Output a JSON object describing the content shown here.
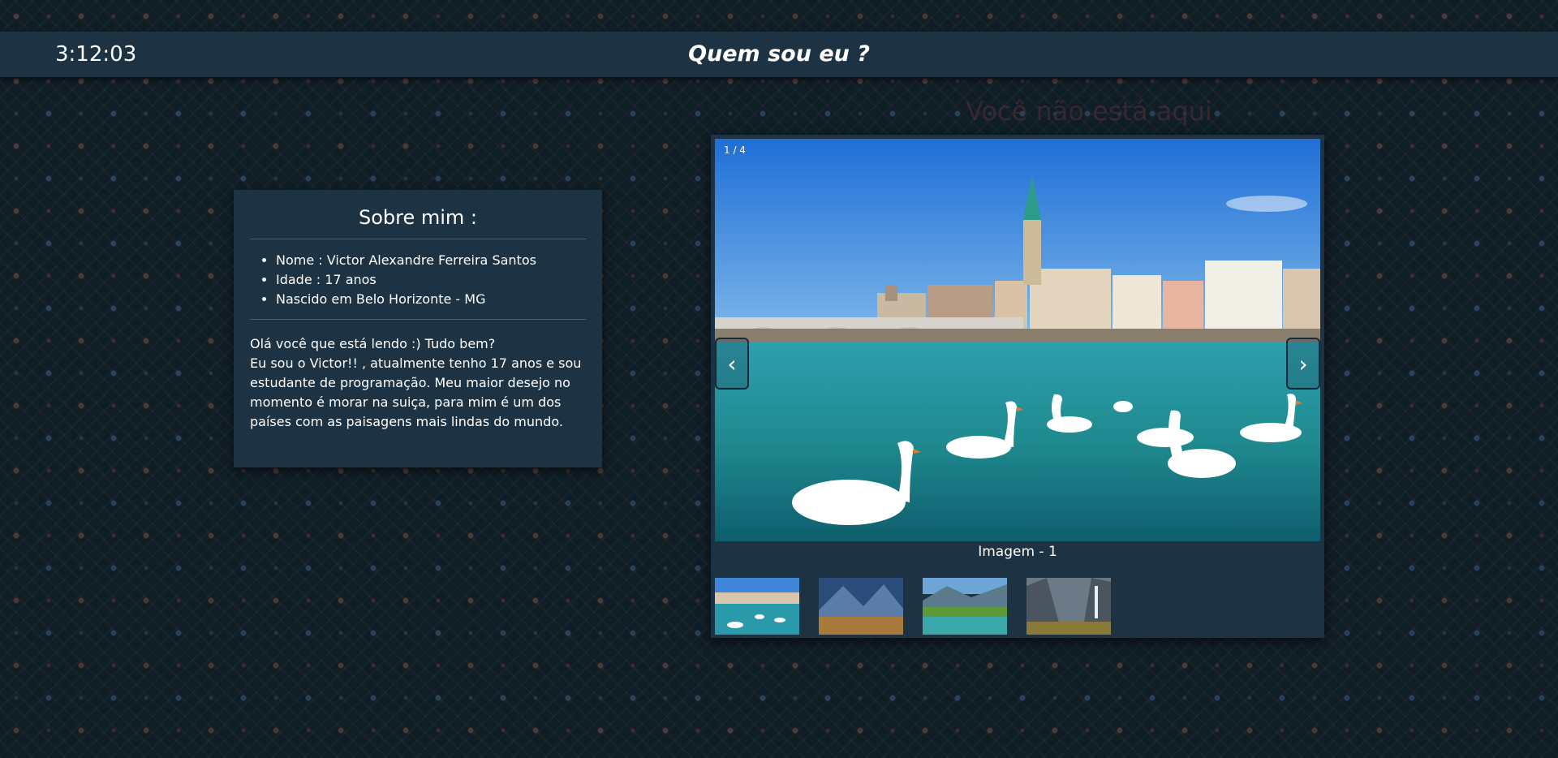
{
  "header": {
    "clock": "3:12:03",
    "title": "Quem sou eu ?"
  },
  "background_text": "Você não está aqui",
  "about": {
    "title": "Sobre mim :",
    "items": [
      "Nome : Victor Alexandre Ferreira Santos",
      "Idade : 17 anos",
      "Nascido em Belo Horizonte - MG"
    ],
    "paragraph": [
      "Olá você que está lendo :) Tudo bem?",
      "Eu sou o Victor!! , atualmente tenho 17 anos e sou estudante de programação. Meu maior desejo no momento é morar na suiça, para mim é um dos países com as paisagens mais lindas do mundo."
    ]
  },
  "carousel": {
    "counter": "1 / 4",
    "caption": "Imagem - 1",
    "prev_icon": "‹",
    "next_icon": "›",
    "thumbnails": [
      "zurich-swans",
      "mountain-lake-village",
      "alpine-lake-meadow",
      "valley-waterfall"
    ]
  },
  "colors": {
    "header_bg": "#1d3344",
    "page_bg": "#0f1d25",
    "pattern_red": "#cd5c5c",
    "pattern_blue": "#4a6e8c"
  }
}
